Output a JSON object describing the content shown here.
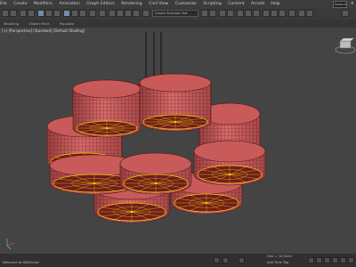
{
  "menu": {
    "items": [
      "File",
      "Create",
      "Modifiers",
      "Animation",
      "Graph Editors",
      "Rendering",
      "Civil View",
      "Customize",
      "Scripting",
      "Content",
      "Arnold",
      "Help"
    ],
    "search_label": "Search",
    "close_glyph": "×"
  },
  "toolbar": {
    "combo_text": "Create Selection Set"
  },
  "ribbon": {
    "items": [
      "Modeling",
      "Object Paint",
      "Populate"
    ]
  },
  "viewport": {
    "label": "[+] [Perspective] [Standard] [Default Shading]",
    "background": "#444444",
    "shade_color": "#c85a5a",
    "inner_color": "#6e1e1e",
    "wire_color": "#ffd400"
  },
  "status": {
    "left_text": "Welcome to MAXScript",
    "grid_text": "Grid = 10,0mm",
    "key_text": "Add Time Tag"
  },
  "icons": [
    "viewcube-icon",
    "select-icon",
    "move-icon",
    "rotate-icon",
    "scale-icon",
    "snap-icon",
    "play-icon"
  ]
}
